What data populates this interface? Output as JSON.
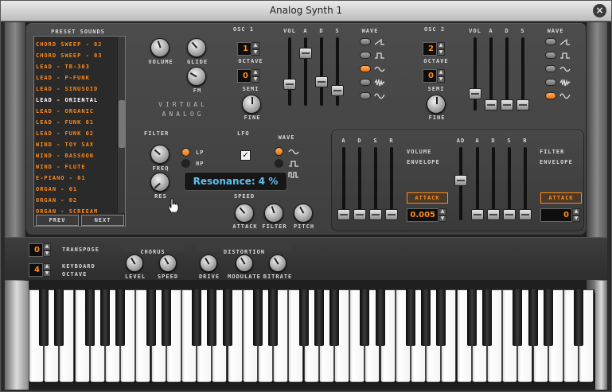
{
  "window": {
    "title": "Analog Synth 1",
    "close": "×"
  },
  "preset": {
    "heading": "PRESET SOUNDS",
    "items": [
      "CHORD SWEEP - 02",
      "CHORD SWEEP - 03",
      "LEAD - TB-303",
      "LEAD - P-FUNK",
      "LEAD - SINUSOID",
      "LEAD - ORIENTAL",
      "LEAD - ORGANIC",
      "LEAD - FUNK 01",
      "LEAD - FUNK 02",
      "WIND - TOY SAX",
      "WIND - BASSOON",
      "WIND - FLUTE",
      "E-PIANO - 01",
      "ORGAN - 01",
      "ORGAN - 02",
      "ORGAN - SCREEAM"
    ],
    "selected_index": 5,
    "prev": "PREV",
    "next": "NEXT"
  },
  "main": {
    "volume": "VOLUME",
    "glide": "GLIDE",
    "fm": "FM",
    "brand_line1": "VIRTUAL",
    "brand_line2": "ANALOG"
  },
  "osc1": {
    "title": "OSC 1",
    "octave_label": "OCTAVE",
    "octave": "1",
    "semi_label": "SEMI",
    "semi": "0",
    "fine": "FINE",
    "vol": "VOL",
    "a": "A",
    "d": "D",
    "s": "S",
    "wave": "WAVE",
    "levels": [
      0.28,
      0.82,
      0.32,
      0.16
    ],
    "wave_selected": 2
  },
  "osc2": {
    "title": "OSC 2",
    "octave_label": "OCTAVE",
    "octave": "2",
    "semi_label": "SEMI",
    "semi": "0",
    "fine": "FINE",
    "vol": "VOL",
    "a": "A",
    "d": "D",
    "s": "S",
    "wave": "WAVE",
    "levels": [
      0.18,
      0.0,
      0.0,
      0.0
    ],
    "wave_selected": 4
  },
  "filter": {
    "title": "FILTER",
    "freq": "FREQ",
    "res": "RES",
    "lp": "LP",
    "hp": "HP",
    "lp_on": true
  },
  "lfo": {
    "title": "LFO",
    "wave": "WAVE",
    "speed": "SPEED",
    "attack": "ATTACK",
    "filter": "FILTER",
    "pitch": "PITCH",
    "enabled": true
  },
  "volenv": {
    "a": "A",
    "d": "D",
    "s": "S",
    "r": "R",
    "label1": "VOLUME",
    "label2": "ENVELOPE",
    "attack_btn": "ATTACK",
    "value": "0.005",
    "levels": [
      0.0,
      0.0,
      0.0,
      0.0
    ]
  },
  "filtenv": {
    "ad": "AD",
    "a": "A",
    "d": "D",
    "s": "S",
    "r": "R",
    "label1": "FILTER",
    "label2": "ENVELOPE",
    "attack_btn": "ATTACK",
    "value": "0",
    "levels": [
      0.55,
      0.0,
      0.0,
      0.0,
      0.0
    ]
  },
  "bottom": {
    "transpose_label": "TRANSPOSE",
    "transpose": "0",
    "keyboard_label1": "KEYBOARD",
    "keyboard_label2": "OCTAVE",
    "keyboard_octave": "4",
    "chorus": "CHORUS",
    "level": "LEVEL",
    "speed": "SPEED",
    "distortion": "DISTORTION",
    "drive": "DRIVE",
    "modulate": "MODULATE",
    "bitrate": "BITRATE"
  },
  "tooltip": {
    "text": "Resonance: 4 %"
  },
  "colors": {
    "accent": "#ff8a1c",
    "tooltip": "#5ec1f2",
    "panel": "#444444"
  }
}
